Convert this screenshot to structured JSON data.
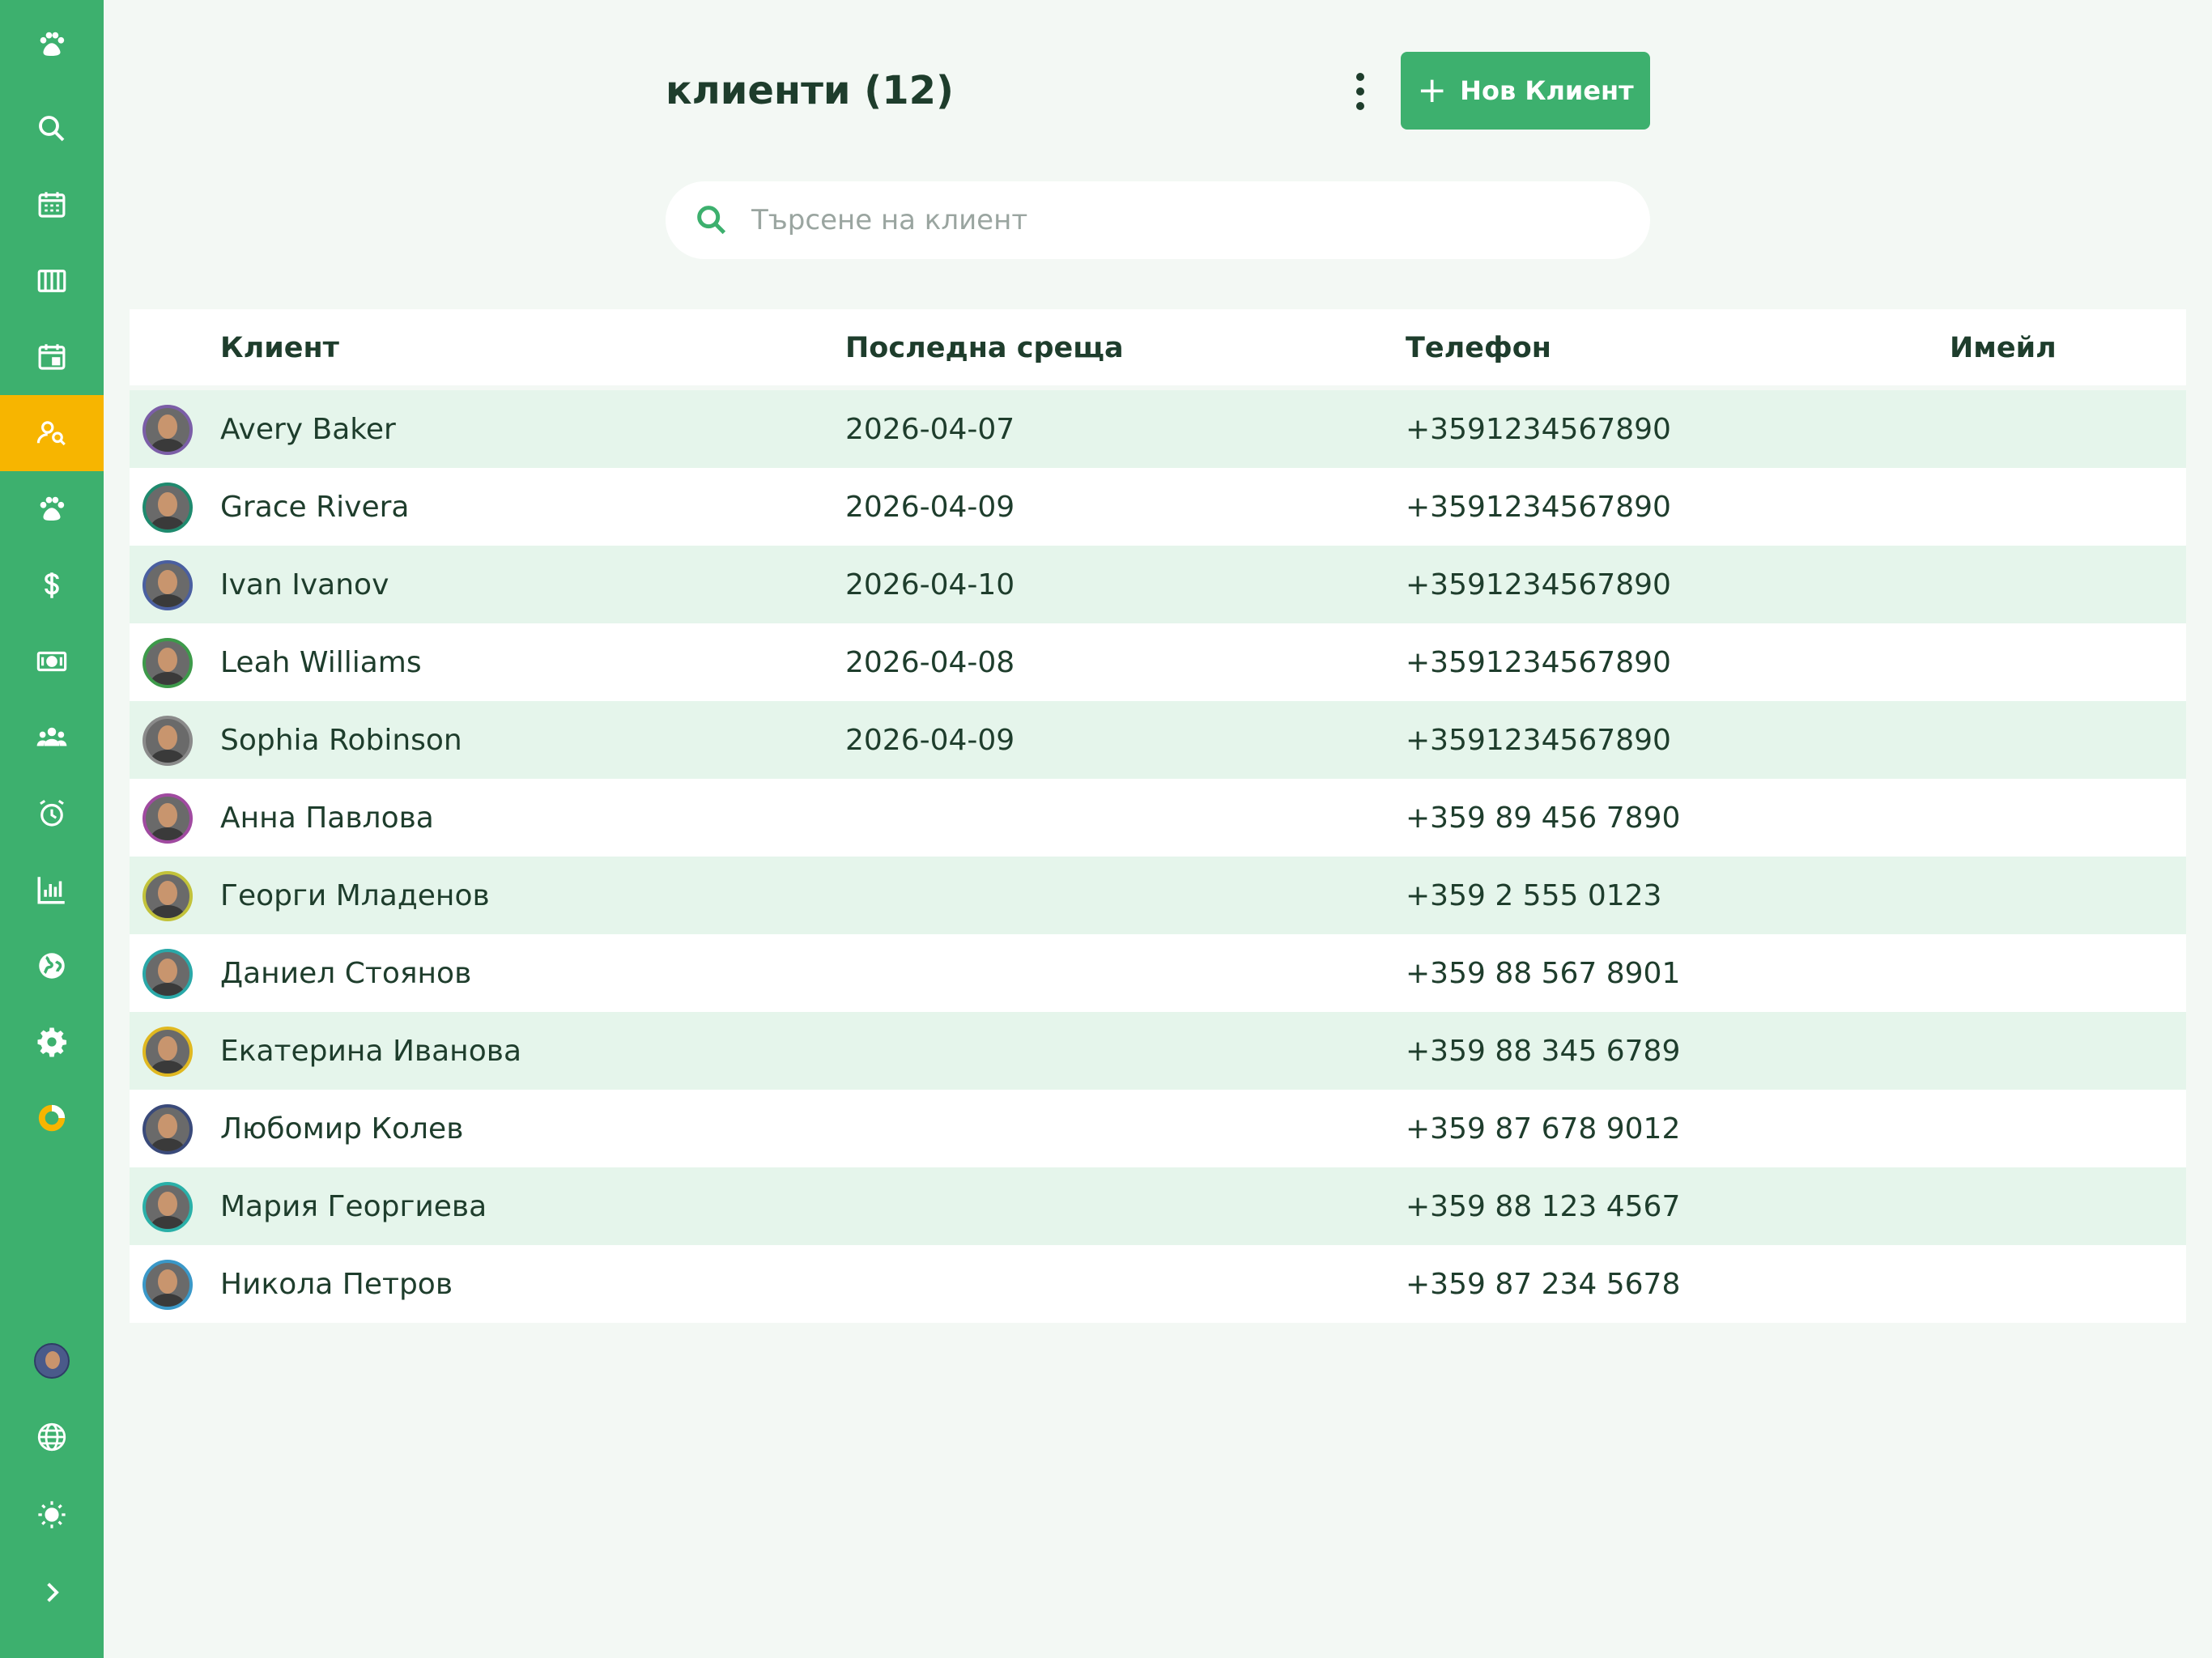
{
  "header": {
    "title": "клиенти (12)",
    "new_client_label": "Нов Клиент"
  },
  "search": {
    "placeholder": "Търсене на клиент"
  },
  "sidebar": {
    "items": [
      {
        "icon": "paw-logo-icon"
      },
      {
        "icon": "search-icon"
      },
      {
        "icon": "calendar-grid-icon"
      },
      {
        "icon": "columns-icon"
      },
      {
        "icon": "calendar-day-icon"
      },
      {
        "icon": "client-search-icon",
        "active": true
      },
      {
        "icon": "paw-icon"
      },
      {
        "icon": "dollar-icon"
      },
      {
        "icon": "cash-icon"
      },
      {
        "icon": "group-icon"
      },
      {
        "icon": "alarm-icon"
      },
      {
        "icon": "bar-chart-icon"
      },
      {
        "icon": "globe-icon"
      },
      {
        "icon": "gear-icon"
      },
      {
        "icon": "donut-icon"
      }
    ],
    "bottom": [
      {
        "icon": "user-avatar"
      },
      {
        "icon": "language-globe-icon"
      },
      {
        "icon": "sun-icon"
      },
      {
        "icon": "chevron-right-icon"
      }
    ]
  },
  "table": {
    "columns": [
      "Клиент",
      "Последна среща",
      "Телефон",
      "Имейл"
    ],
    "rows": [
      {
        "name": "Avery Baker",
        "last_meeting": "2026-04-07",
        "phone": "+3591234567890",
        "email": "",
        "avatar_ring": "#7b5ea7"
      },
      {
        "name": "Grace Rivera",
        "last_meeting": "2026-04-09",
        "phone": "+3591234567890",
        "email": "",
        "avatar_ring": "#1f8a6e"
      },
      {
        "name": "Ivan Ivanov",
        "last_meeting": "2026-04-10",
        "phone": "+3591234567890",
        "email": "",
        "avatar_ring": "#4a5fa0"
      },
      {
        "name": "Leah Williams",
        "last_meeting": "2026-04-08",
        "phone": "+3591234567890",
        "email": "",
        "avatar_ring": "#3d9a4a"
      },
      {
        "name": "Sophia Robinson",
        "last_meeting": "2026-04-09",
        "phone": "+3591234567890",
        "email": "",
        "avatar_ring": "#8a8a8a"
      },
      {
        "name": "Анна Павлова",
        "last_meeting": "",
        "phone": "+359 89 456 7890",
        "email": "",
        "avatar_ring": "#a04aa0"
      },
      {
        "name": "Георги Младенов",
        "last_meeting": "",
        "phone": "+359 2 555 0123",
        "email": "",
        "avatar_ring": "#c2c23a"
      },
      {
        "name": "Даниел Стоянов",
        "last_meeting": "",
        "phone": "+359 88 567 8901",
        "email": "",
        "avatar_ring": "#2aa8a8"
      },
      {
        "name": "Екатерина Иванова",
        "last_meeting": "",
        "phone": "+359 88 345 6789",
        "email": "",
        "avatar_ring": "#e0b820"
      },
      {
        "name": "Любомир Колев",
        "last_meeting": "",
        "phone": "+359 87 678 9012",
        "email": "",
        "avatar_ring": "#3a4a7a"
      },
      {
        "name": "Мария Георгиева",
        "last_meeting": "",
        "phone": "+359 88 123 4567",
        "email": "",
        "avatar_ring": "#2ab0a8"
      },
      {
        "name": "Никола Петров",
        "last_meeting": "",
        "phone": "+359 87 234 5678",
        "email": "",
        "avatar_ring": "#3a98c8"
      }
    ]
  },
  "colors": {
    "sidebar": "#3db06e",
    "active": "#f7b500",
    "accent": "#3db06e",
    "text": "#1e3d2c"
  }
}
